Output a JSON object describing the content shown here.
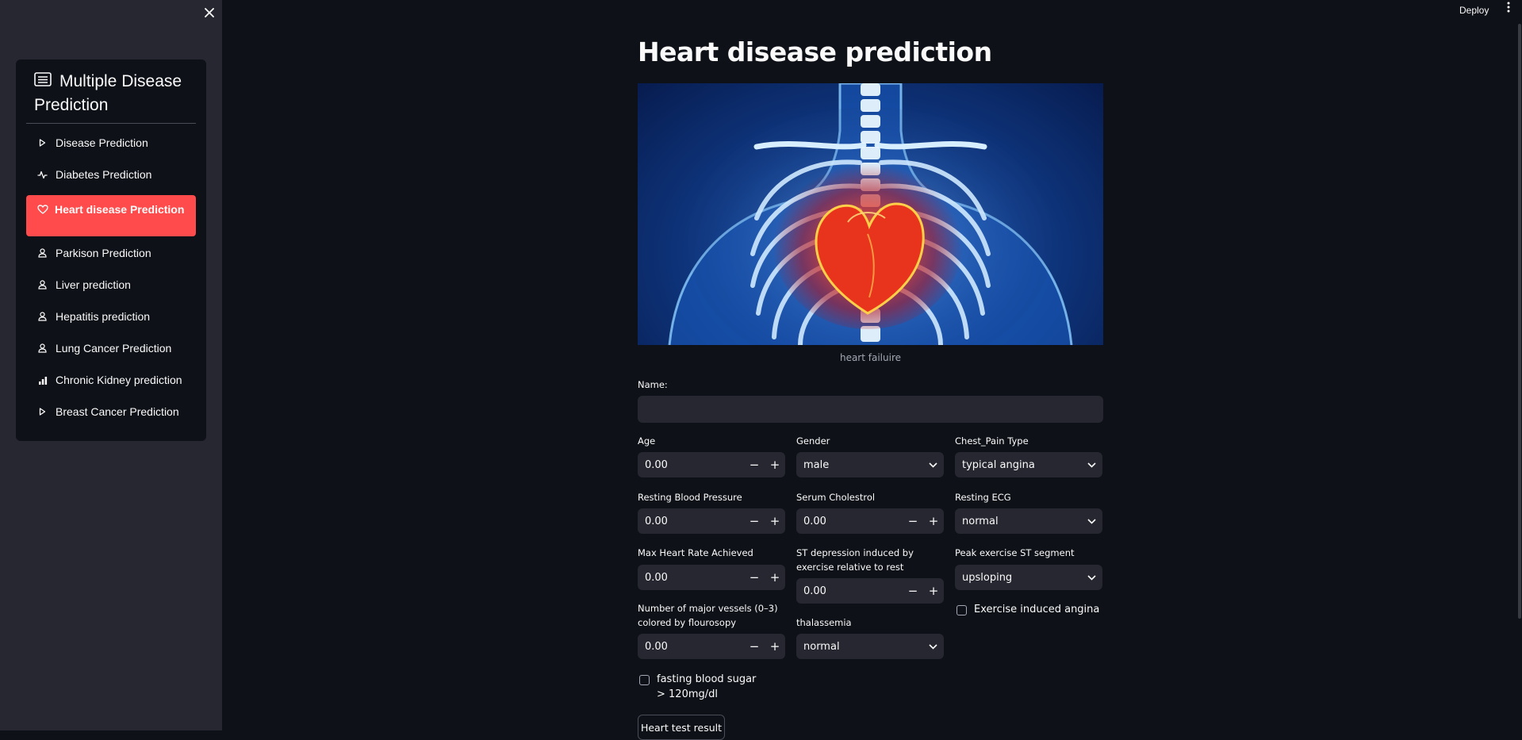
{
  "sidebar": {
    "close_icon": "close-icon",
    "menu_title": "Multiple Disease Prediction",
    "menu_icon": "list-icon",
    "items": [
      {
        "label": "Disease Prediction",
        "icon": "play-icon"
      },
      {
        "label": "Diabetes Prediction",
        "icon": "activity-icon"
      },
      {
        "label": "Heart disease Prediction",
        "icon": "heart-icon",
        "active": true
      },
      {
        "label": "Parkison Prediction",
        "icon": "person-icon"
      },
      {
        "label": "Liver prediction",
        "icon": "person-icon"
      },
      {
        "label": "Hepatitis prediction",
        "icon": "person-icon"
      },
      {
        "label": "Lung Cancer Prediction",
        "icon": "person-icon"
      },
      {
        "label": "Chronic Kidney prediction",
        "icon": "bar-chart-icon"
      },
      {
        "label": "Breast Cancer Prediction",
        "icon": "play-icon"
      }
    ],
    "active_color": "#ff4b4b"
  },
  "header": {
    "deploy_label": "Deploy",
    "menu_icon": "more-vertical-icon"
  },
  "main": {
    "title": "Heart disease prediction",
    "image_caption": "heart failuire",
    "name_label": "Name:",
    "name_value": "",
    "fields": {
      "age": {
        "label": "Age",
        "value": "0.00"
      },
      "gender": {
        "label": "Gender",
        "value": "male"
      },
      "chest_pain": {
        "label": "Chest_Pain Type",
        "value": "typical angina"
      },
      "resting_bp": {
        "label": "Resting Blood Pressure",
        "value": "0.00"
      },
      "serum_chol": {
        "label": "Serum Cholestrol",
        "value": "0.00"
      },
      "resting_ecg": {
        "label": "Resting ECG",
        "value": "normal"
      },
      "max_hr": {
        "label": "Max Heart Rate Achieved",
        "value": "0.00"
      },
      "st_depression": {
        "label": "ST depression induced by exercise relative to rest",
        "value": "0.00"
      },
      "peak_st": {
        "label": "Peak exercise ST segment",
        "value": "upsloping"
      },
      "exercise_angina": {
        "label": "Exercise induced angina",
        "checked": false
      },
      "major_vessels": {
        "label": "Number of major vessels (0–3) colored by flourosopy",
        "value": "0.00"
      },
      "thalassemia": {
        "label": "thalassemia",
        "value": "normal"
      },
      "fasting_bs": {
        "label": "fasting blood sugar > 120mg/dl",
        "checked": false
      }
    },
    "stepper_minus": "−",
    "stepper_plus": "+",
    "submit_label": "Heart test result"
  },
  "colors": {
    "background": "#0e1117",
    "sidebar": "#262730",
    "input": "#262730",
    "accent": "#ff4b4b"
  }
}
